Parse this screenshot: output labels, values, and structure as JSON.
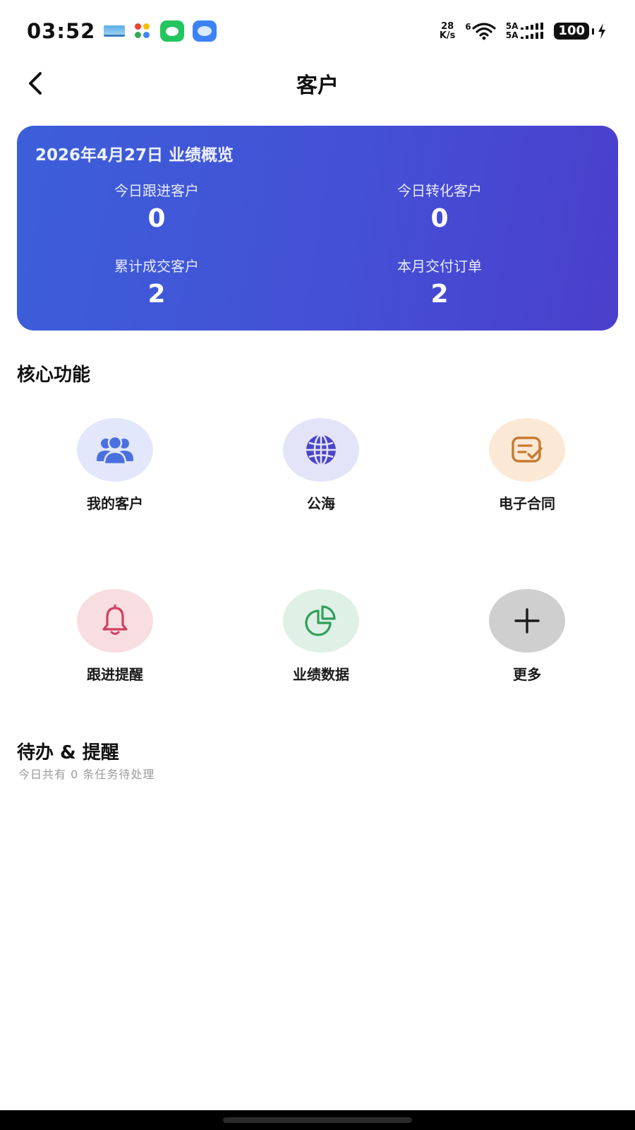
{
  "status_bar": {
    "time": "03:52",
    "net_speed_value": "28",
    "net_speed_unit": "K/s",
    "wifi_label": "6",
    "sim1_label": "5A",
    "sim2_label": "5A",
    "battery": "100"
  },
  "header": {
    "title": "客户"
  },
  "overview": {
    "title": "2026年4月27日 业绩概览",
    "stats": [
      {
        "label": "今日跟进客户",
        "value": "0"
      },
      {
        "label": "今日转化客户",
        "value": "0"
      },
      {
        "label": "累计成交客户",
        "value": "2"
      },
      {
        "label": "本月交付订单",
        "value": "2"
      }
    ],
    "gradient_start": "#3c5fd8",
    "gradient_end": "#4a3fcc"
  },
  "core": {
    "title": "核心功能",
    "items": [
      {
        "label": "我的客户",
        "icon": "users-icon",
        "bg": "#e3e7fb",
        "color": "#4a6fe0"
      },
      {
        "label": "公海",
        "icon": "globe-icon",
        "bg": "#e4e4f8",
        "color": "#4a45c8"
      },
      {
        "label": "电子合同",
        "icon": "contract-icon",
        "bg": "#fbe9d6",
        "color": "#c87a30"
      },
      {
        "label": "跟进提醒",
        "icon": "bell-icon",
        "bg": "#f8dde1",
        "color": "#d04060"
      },
      {
        "label": "业绩数据",
        "icon": "pie-chart-icon",
        "bg": "#dff0e6",
        "color": "#30a05a"
      },
      {
        "label": "更多",
        "icon": "plus-icon",
        "bg": "#cfcfcf",
        "color": "#1a1a1a"
      }
    ]
  },
  "todo": {
    "title": "待办 & 提醒",
    "subtitle": "今日共有 0 条任务待处理"
  }
}
